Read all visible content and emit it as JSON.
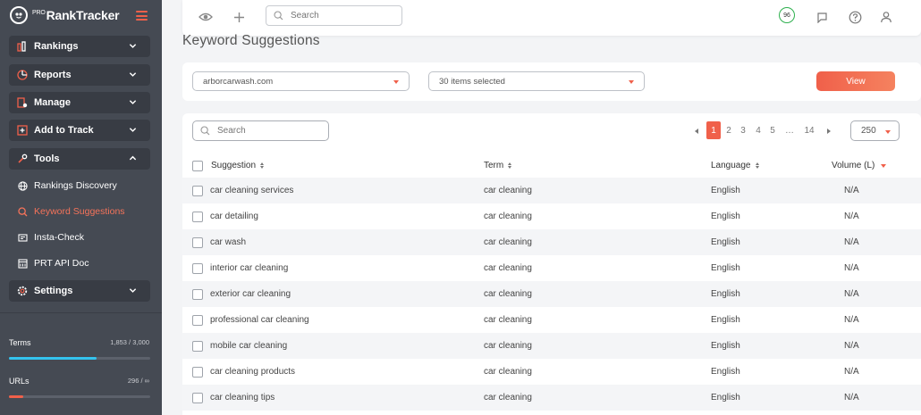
{
  "app": {
    "logo_prefix": "PRO",
    "logo_text": "RankTracker"
  },
  "sidebar": {
    "nav": [
      {
        "label": "Rankings",
        "icon": "rankings-icon",
        "expanded": false
      },
      {
        "label": "Reports",
        "icon": "reports-icon",
        "expanded": false
      },
      {
        "label": "Manage",
        "icon": "manage-icon",
        "expanded": false
      },
      {
        "label": "Add to Track",
        "icon": "add-to-track-icon",
        "expanded": false
      },
      {
        "label": "Tools",
        "icon": "tools-icon",
        "expanded": true
      }
    ],
    "tools_items": [
      {
        "label": "Rankings Discovery",
        "icon": "globe-icon",
        "active": false
      },
      {
        "label": "Keyword Suggestions",
        "icon": "keyword-search-icon",
        "active": true
      },
      {
        "label": "Insta-Check",
        "icon": "insta-check-icon",
        "active": false
      },
      {
        "label": "PRT API Doc",
        "icon": "api-doc-icon",
        "active": false
      }
    ],
    "settings": {
      "label": "Settings",
      "icon": "settings-gear-icon"
    },
    "meters": [
      {
        "label": "Terms",
        "value_text": "1,853 / 3,000",
        "fraction": 0.62,
        "color": "#34c3ee"
      },
      {
        "label": "URLs",
        "value_text": "296 / ∞",
        "fraction": 0.1,
        "color": "#f0604a"
      }
    ]
  },
  "topbar": {
    "search_placeholder": "Search",
    "score": "96",
    "icons": [
      "eye-icon",
      "plus-icon",
      "search-icon",
      "score-badge",
      "message-icon",
      "help-icon",
      "user-icon"
    ]
  },
  "page": {
    "title": "Keyword Suggestions"
  },
  "filters": {
    "domain": "arborcarwash.com",
    "items": "30 items selected",
    "view_label": "View"
  },
  "table": {
    "search_placeholder": "Search",
    "pagination": {
      "pages": [
        "1",
        "2",
        "3",
        "4",
        "5",
        "…",
        "14"
      ],
      "current": "1"
    },
    "per_page": "250",
    "columns": {
      "suggestion": "Suggestion",
      "term": "Term",
      "language": "Language",
      "volume": "Volume (L)"
    },
    "rows": [
      {
        "suggestion": "car cleaning services",
        "term": "car cleaning",
        "language": "English",
        "volume": "N/A"
      },
      {
        "suggestion": "car detailing",
        "term": "car cleaning",
        "language": "English",
        "volume": "N/A"
      },
      {
        "suggestion": "car wash",
        "term": "car cleaning",
        "language": "English",
        "volume": "N/A"
      },
      {
        "suggestion": "interior car cleaning",
        "term": "car cleaning",
        "language": "English",
        "volume": "N/A"
      },
      {
        "suggestion": "exterior car cleaning",
        "term": "car cleaning",
        "language": "English",
        "volume": "N/A"
      },
      {
        "suggestion": "professional car cleaning",
        "term": "car cleaning",
        "language": "English",
        "volume": "N/A"
      },
      {
        "suggestion": "mobile car cleaning",
        "term": "car cleaning",
        "language": "English",
        "volume": "N/A"
      },
      {
        "suggestion": "car cleaning products",
        "term": "car cleaning",
        "language": "English",
        "volume": "N/A"
      },
      {
        "suggestion": "car cleaning tips",
        "term": "car cleaning",
        "language": "English",
        "volume": "N/A"
      }
    ]
  },
  "colors": {
    "accent": "#f0604a",
    "sidebar_bg": "#454a53",
    "sidebar_button": "#383c44",
    "score_ring": "#2eb04e"
  }
}
